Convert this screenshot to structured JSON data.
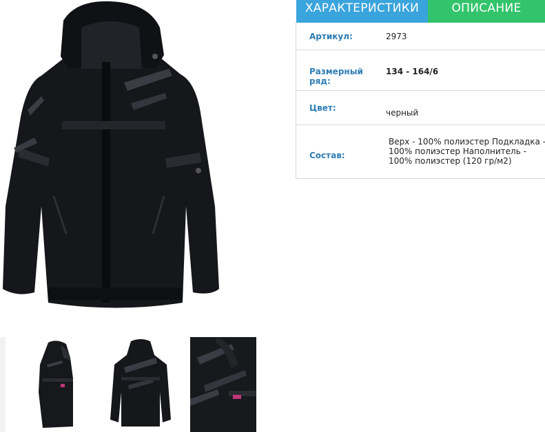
{
  "tabs": {
    "specs_label": "ХАРАКТЕРИСТИКИ",
    "description_label": "ОПИСАНИЕ",
    "specs_color": "#3aa4dc",
    "description_color": "#33c46b"
  },
  "specs": [
    {
      "label": "Артикул:",
      "value": "2973"
    },
    {
      "label": "Размерный ряд:",
      "value": "134 - 164/6"
    },
    {
      "label": "Цвет:",
      "value": "черный"
    },
    {
      "label": "Состав:",
      "value": "Верх - 100% полиэстер Подкладка - 100% полиэстер Наполнитель - 100% полиэстер (120 гр/м2)"
    }
  ],
  "gallery": {
    "main_image": "black-jacket-front",
    "thumbnails": [
      "black-jacket-side",
      "black-jacket-back",
      "black-jacket-detail"
    ]
  }
}
